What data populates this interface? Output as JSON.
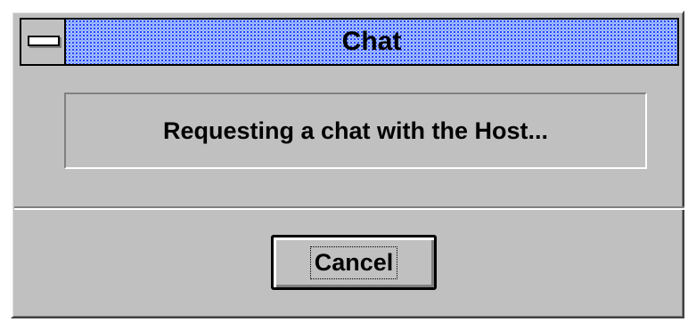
{
  "window": {
    "title": "Chat",
    "system_menu_icon": "system-menu-icon",
    "colors": {
      "face": "#c0c0c0",
      "title_dither_dark": "#2040ff",
      "title_dither_light": "#7fb0ff"
    }
  },
  "dialog": {
    "message": "Requesting a chat with the Host...",
    "cancel_label": "Cancel"
  }
}
